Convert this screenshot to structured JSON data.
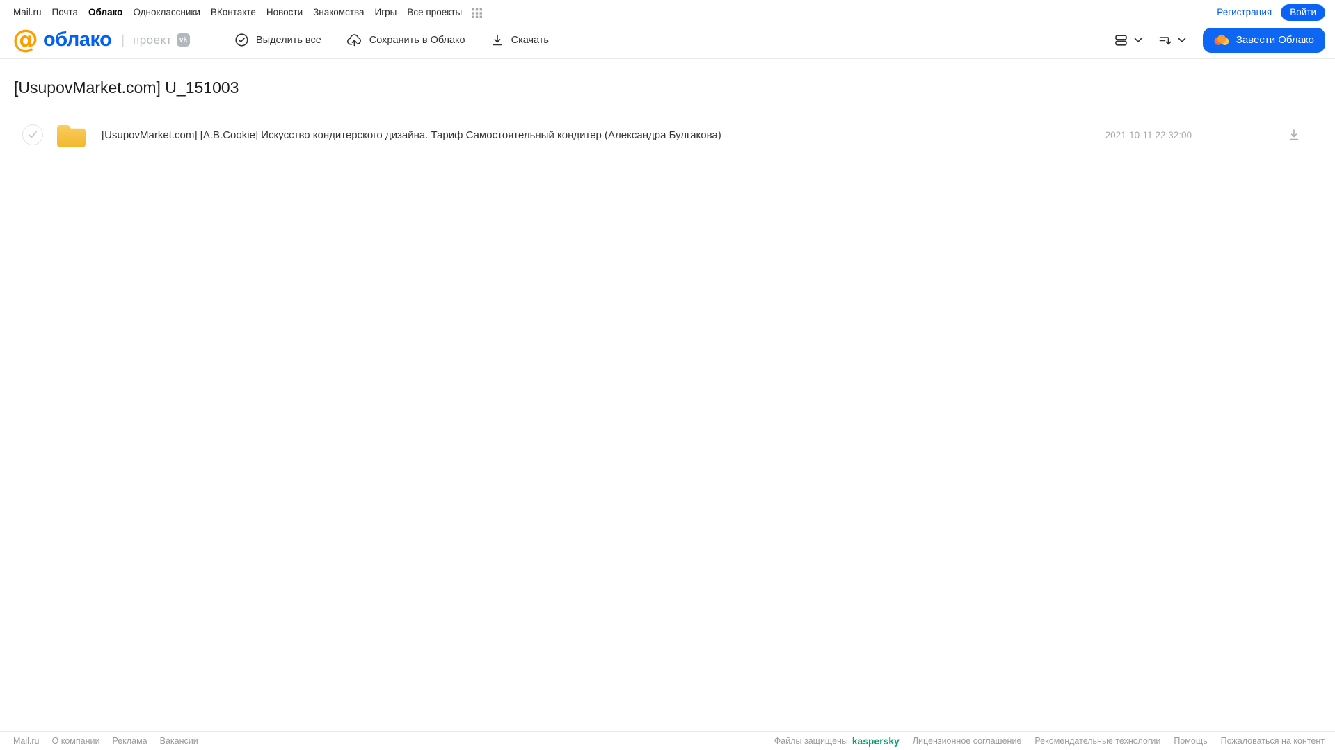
{
  "colors": {
    "accent_blue": "#0d67f2",
    "link_blue": "#0460f0",
    "logo_orange": "#ff9e00",
    "folder_yellow_top": "#f9cd60",
    "folder_yellow_bottom": "#f2b82e",
    "kaspersky_green": "#00a273",
    "muted_gray": "#9b9b9b"
  },
  "icons": {
    "grid-icon": "3x3 dot grid",
    "mailru-at-icon": "@",
    "vk-badge-icon": "vk",
    "check-circle-icon": "circled checkmark",
    "cloud-upload-icon": "cloud with up arrow",
    "download-icon": "down arrow with bar",
    "list-view-icon": "two stacked rows",
    "sort-icon": "lines with down arrow",
    "chevron-down-icon": "v",
    "cloud-logo-icon": "orange cloud",
    "folder-icon": "yellow folder",
    "checkbox-check-icon": "checkmark"
  },
  "top_nav": {
    "items": [
      "Mail.ru",
      "Почта",
      "Облако",
      "Одноклассники",
      "ВКонтакте",
      "Новости",
      "Знакомства",
      "Игры",
      "Все проекты"
    ],
    "registration": "Регистрация",
    "login": "Войти"
  },
  "header": {
    "logo_at": "@",
    "logo_text": "облако",
    "project_label": "проект",
    "vk_badge": "vk",
    "toolbar": [
      {
        "label": "Выделить все"
      },
      {
        "label": "Сохранить в Облако"
      },
      {
        "label": "Скачать"
      }
    ],
    "create_cloud_label": "Завести Облако"
  },
  "main": {
    "title": "[UsupovMarket.com] U_151003",
    "files": [
      {
        "name": "[UsupovMarket.com] [A.B.Cookie] Искусство кондитерского дизайна. Тариф Самостоятельный кондитер (Александра Булгакова)",
        "date": "2021-10-11 22:32:00"
      }
    ]
  },
  "footer": {
    "left": [
      "Mail.ru",
      "О компании",
      "Реклама",
      "Вакансии"
    ],
    "protected_label": "Файлы защищены",
    "kaspersky_label": "kaspersky",
    "links": [
      "Лицензионное соглашение",
      "Рекомендательные технологии",
      "Помощь",
      "Пожаловаться на контент"
    ]
  }
}
